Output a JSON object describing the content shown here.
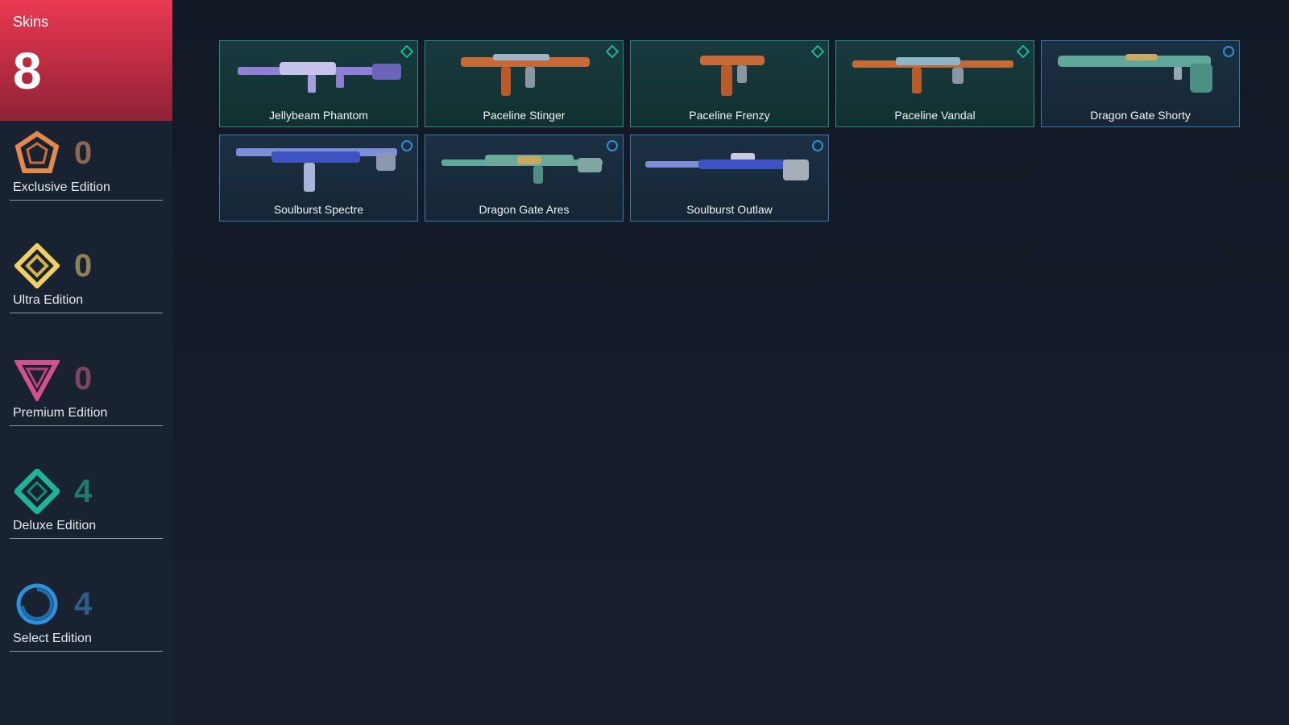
{
  "summary": {
    "label": "Skins",
    "count": "8"
  },
  "tiers": [
    {
      "name": "Exclusive Edition",
      "count": "0",
      "icon": "exclusive-edition-icon",
      "color": "#e2894d",
      "count_color": "#8a6a52"
    },
    {
      "name": "Ultra Edition",
      "count": "0",
      "icon": "ultra-edition-icon",
      "color": "#f0cf63",
      "count_color": "#8f8256"
    },
    {
      "name": "Premium Edition",
      "count": "0",
      "icon": "premium-edition-icon",
      "color": "#d2508e",
      "count_color": "#7a4660"
    },
    {
      "name": "Deluxe Edition",
      "count": "4",
      "icon": "deluxe-edition-icon",
      "color": "#1fb39a",
      "count_color": "#1f7a6d"
    },
    {
      "name": "Select Edition",
      "count": "4",
      "icon": "select-edition-icon",
      "color": "#2f8fd8",
      "count_color": "#2c5f86"
    }
  ],
  "skins": [
    {
      "name": "Jellybeam Phantom",
      "tier": "deluxe"
    },
    {
      "name": "Paceline Stinger",
      "tier": "deluxe"
    },
    {
      "name": "Paceline Frenzy",
      "tier": "deluxe"
    },
    {
      "name": "Paceline Vandal",
      "tier": "deluxe"
    },
    {
      "name": "Dragon Gate Shorty",
      "tier": "select"
    },
    {
      "name": "Soulburst Spectre",
      "tier": "select"
    },
    {
      "name": "Dragon Gate Ares",
      "tier": "select"
    },
    {
      "name": "Soulburst Outlaw",
      "tier": "select"
    }
  ]
}
